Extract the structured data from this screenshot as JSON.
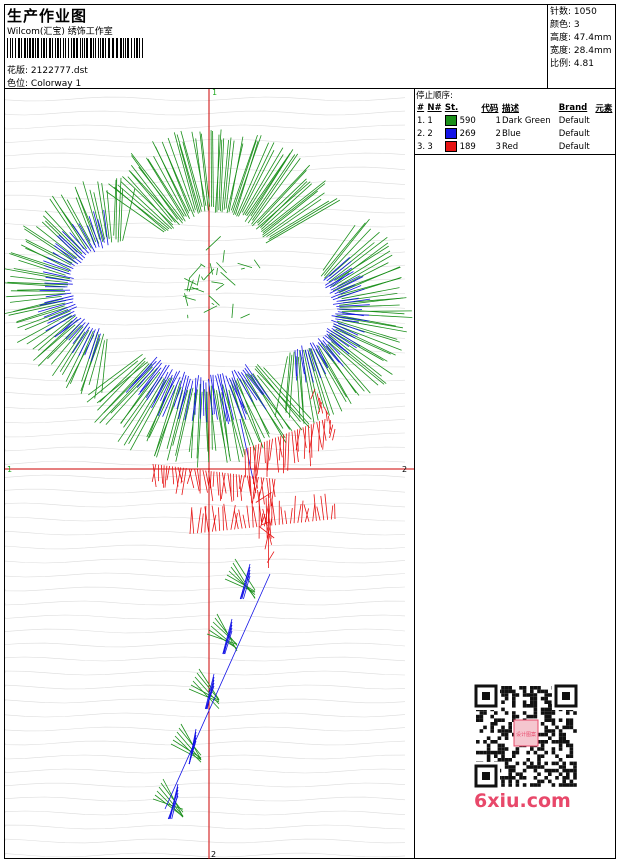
{
  "header": {
    "title": "生产作业图",
    "company": "Wilcom(汇宝) 绣饰工作室",
    "file_label": "花版:",
    "file_name": "2122777.dst",
    "colorway_label": "色位:",
    "colorway": "Colorway 1"
  },
  "stats": {
    "stitches_label": "针数:",
    "stitches": "1050",
    "colors_label": "颜色:",
    "colors": "3",
    "height_label": "高度:",
    "height": "47.4mm",
    "width_label": "宽度:",
    "width": "28.4mm",
    "ratio_label": "比例:",
    "ratio": "4.81"
  },
  "legend": {
    "heading": "停止顺序:",
    "columns": [
      "#",
      "N#",
      "St.",
      "代码",
      "描述",
      "Brand",
      "元素"
    ],
    "rows": [
      {
        "index": "1.",
        "needle": "1",
        "color": "#1a8f1a",
        "stitches": "590",
        "code": "1",
        "description": "Dark Green",
        "brand": "Default"
      },
      {
        "index": "2.",
        "needle": "2",
        "color": "#1414e6",
        "stitches": "269",
        "code": "2",
        "description": "Blue",
        "brand": "Default"
      },
      {
        "index": "3.",
        "needle": "3",
        "color": "#e61414",
        "stitches": "189",
        "code": "3",
        "description": "Red",
        "brand": "Default"
      }
    ]
  },
  "axes": {
    "top": "1",
    "bottom": "2",
    "left": "1",
    "right": "2",
    "axis_color": "#cc0000"
  },
  "watermark": {
    "text": "6xiu.com",
    "stamp": "设计图案"
  }
}
